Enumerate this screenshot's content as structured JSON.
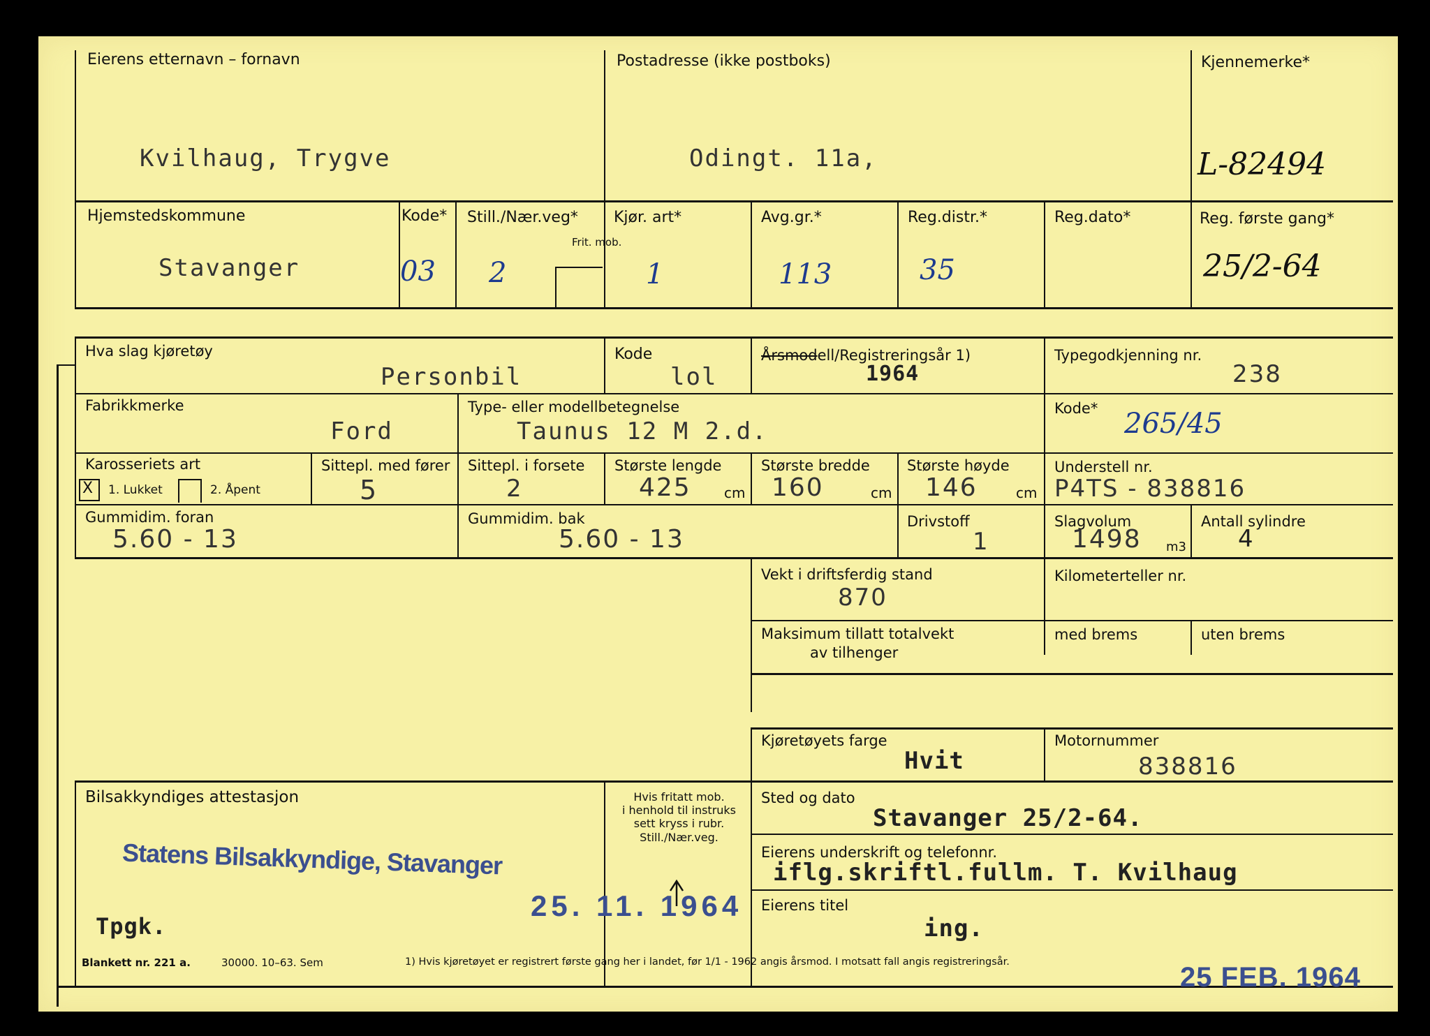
{
  "owner": {
    "name_label": "Eierens etternavn – fornavn",
    "name_value": "Kvilhaug, Trygve",
    "address_label": "Postadresse (ikke postboks)",
    "address_value": "Odingt. 11a,",
    "reg_mark_label": "Kjennemerke*",
    "reg_mark_value": "L-82494"
  },
  "registration": {
    "municipality_label": "Hjemstedskommune",
    "municipality_value": "Stavanger",
    "code_label": "Kode*",
    "code_value": "03",
    "still_label": "Still./Nær.veg*",
    "frit_mob_label": "Frit. mob.",
    "still_value": "2",
    "drive_type_label": "Kjør. art*",
    "drive_type_value": "1",
    "fee_group_label": "Avg.gr.*",
    "fee_group_value": "113",
    "reg_district_label": "Reg.distr.*",
    "reg_district_value": "35",
    "reg_date_label": "Reg.dato*",
    "first_reg_label": "Reg. første gang*",
    "first_reg_value": "25/2-64"
  },
  "vehicle": {
    "kind_label": "Hva slag kjøretøy",
    "kind_value": "Personbil",
    "kind_code_label": "Kode",
    "kind_code_value": "lol",
    "year_label_struck": "Årsmod",
    "year_label_rest": "ell/Registreringsår 1)",
    "year_value": "1964",
    "type_approval_label": "Typegodkjenning nr.",
    "type_approval_value": "238",
    "make_label": "Fabrikkmerke",
    "make_value": "Ford",
    "model_label": "Type- eller modellbetegnelse",
    "model_value": "Taunus 12 M 2.d.",
    "code2_label": "Kode*",
    "code2_value": "265/45",
    "body_label": "Karosseriets art",
    "body_opt1_mark": "X",
    "body_opt1": "1. Lukket",
    "body_opt2": "2. Åpent",
    "seats_driver_label": "Sittepl. med fører",
    "seats_driver_value": "5",
    "seats_front_label": "Sittepl. i forsete",
    "seats_front_value": "2",
    "length_label": "Største lengde",
    "length_value": "425",
    "width_label": "Største bredde",
    "width_value": "160",
    "height_label": "Største høyde",
    "height_value": "146",
    "unit_cm": "cm",
    "chassis_label": "Understell nr.",
    "chassis_value": "P4TS - 838816",
    "tyre_front_label": "Gummidim. foran",
    "tyre_front_value": "5.60 - 13",
    "tyre_rear_label": "Gummidim. bak",
    "tyre_rear_value": "5.60 - 13",
    "fuel_label": "Drivstoff",
    "fuel_value": "1",
    "displacement_label": "Slagvolum",
    "displacement_value": "1498",
    "unit_m3": "m3",
    "cylinders_label": "Antall sylindre",
    "cylinders_value": "4",
    "weight_label": "Vekt i driftsferdig stand",
    "weight_value": "870",
    "odometer_label": "Kilometerteller nr.",
    "max_trailer_label_1": "Maksimum tillatt totalvekt",
    "max_trailer_label_2": "av tilhenger",
    "with_brakes_label": "med brems",
    "without_brakes_label": "uten brems",
    "color_label": "Kjøretøyets farge",
    "color_value": "Hvit",
    "engine_no_label": "Motornummer",
    "engine_no_value": "838816"
  },
  "attestation": {
    "label": "Bilsakkyndiges attestasjon",
    "stamp_text": "Statens Bilsakkyndige, Stavanger",
    "stamp_date": "25. 11. 1964",
    "tpgk": "Tpgk.",
    "note_lines": [
      "Hvis fritatt mob.",
      "i henhold til instruks",
      "sett kryss i rubr.",
      "Still./Nær.veg."
    ]
  },
  "signature": {
    "place_date_label": "Sted og dato",
    "place_date_value": "Stavanger  25/2-64.",
    "owner_sign_label": "Eierens underskrift og telefonnr.",
    "owner_sign_value": "iflg.skriftl.fullm. T. Kvilhaug",
    "owner_title_label": "Eierens titel",
    "owner_title_value": "ing."
  },
  "footer": {
    "form_no": "Blankett nr. 221 a.",
    "print_info": "30000.  10–63.  Sem",
    "footnote": "1)  Hvis kjøretøyet er registrert første gang her i landet, før 1/1 - 1962 angis årsmod.  I motsatt fall angis registreringsår.",
    "received_stamp": "25 FEB. 1964"
  }
}
